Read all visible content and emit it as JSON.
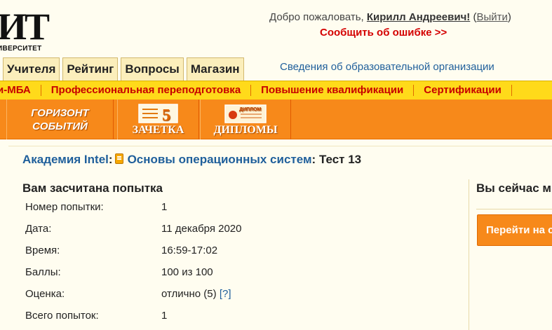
{
  "logo": {
    "big": "ИТ",
    "small": "ИВЕРСИТЕТ"
  },
  "header": {
    "welcome_prefix": "Добро пожаловать,",
    "user_name": "Кирилл Андреевич!",
    "logout_open": "(",
    "logout_label": "Выйти",
    "logout_close": ")",
    "report_error": "Сообщить об ошибке >>"
  },
  "tabs": [
    {
      "label": "Учителя"
    },
    {
      "label": "Рейтинг"
    },
    {
      "label": "Вопросы"
    },
    {
      "label": "Магазин"
    }
  ],
  "org_info_link": "Сведения об образовательной организации",
  "yellow_nav": [
    {
      "label": "и-МБА"
    },
    {
      "label": "Профессиональная переподготовка"
    },
    {
      "label": "Повышение квалификации"
    },
    {
      "label": "Сертификации"
    }
  ],
  "banners": {
    "horizon": {
      "line1": "ГОРИЗОНТ",
      "line2": "СОБЫТИЙ"
    },
    "zachetka": {
      "label": "ЗАЧЕТКА",
      "icon_number": "5"
    },
    "diplomy": {
      "label": "ДИПЛОМЫ",
      "icon_text": "ДИПЛОМ"
    }
  },
  "breadcrumb": {
    "academy": "Академия Intel",
    "colon1": ":",
    "course": "Основы операционных систем",
    "colon2": ":",
    "current": "Тест 13"
  },
  "result": {
    "title": "Вам засчитана попытка",
    "rows": [
      {
        "label": "Номер попытки:",
        "value": "1"
      },
      {
        "label": "Дата:",
        "value": "11 декабря 2020"
      },
      {
        "label": "Время:",
        "value": "16:59-17:02"
      },
      {
        "label": "Баллы:",
        "value": "100 из 100"
      },
      {
        "label": "Оценка:",
        "value": "отлично (5)",
        "help": "[?]"
      },
      {
        "label": "Всего попыток:",
        "value": "1"
      }
    ]
  },
  "right_panel": {
    "title": "Вы сейчас м",
    "button_label": "Перейти на с"
  },
  "colors": {
    "page_bg": "#fffdf0",
    "nav_yellow": "#ffda1a",
    "nav_red_text": "#c60000",
    "orange_bar": "#f7891a",
    "link_blue": "#1f5f9b",
    "error_red": "#d40000"
  }
}
